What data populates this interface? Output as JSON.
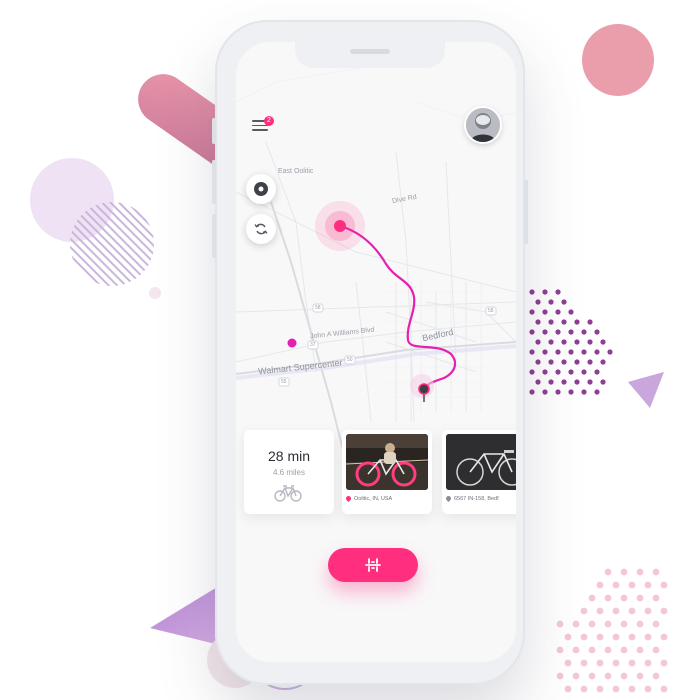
{
  "menu": {
    "badge_count": "2"
  },
  "map": {
    "labels": {
      "east_oolitic": "East Oolitic",
      "dive_rd": "Dive Rd",
      "john_a_williams": "John A Williams Blvd",
      "walmart": "Walmart Supercenter",
      "bedford": "Bedford",
      "road_58_a": "58",
      "road_58_b": "58",
      "road_37": "37",
      "road_50": "50",
      "road_55": "55"
    },
    "route_color": "#e51fb0",
    "marker_color": "#ff2e7e"
  },
  "trip": {
    "time": "28 min",
    "distance": "4.6 miles"
  },
  "places": [
    {
      "label": "Oolitic, IN, USA",
      "pin_color": "#ff2e7e"
    },
    {
      "label": "6567 IN-158, Bedf",
      "pin_color": "#8a8f97"
    }
  ],
  "icons": {
    "menu": "hamburger-icon",
    "compass": "navigation-icon",
    "refresh": "refresh-icon",
    "bike": "bicycle-icon",
    "action": "scan-icon"
  },
  "colors": {
    "accent": "#ff2e7e",
    "purple": "#8e3e95"
  }
}
